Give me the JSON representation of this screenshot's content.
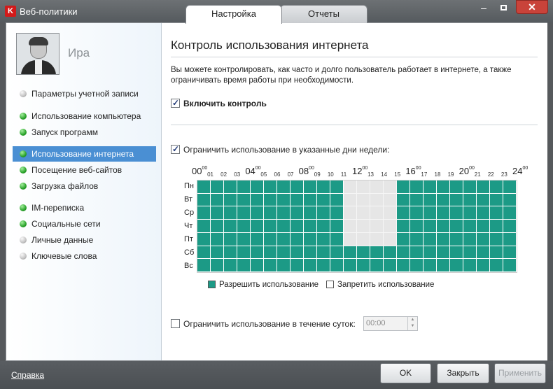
{
  "window": {
    "title": "Веб-политики",
    "app_icon": "K"
  },
  "tabs": [
    {
      "label": "Настройка",
      "active": true
    },
    {
      "label": "Отчеты",
      "active": false
    }
  ],
  "window_buttons": {
    "minimize": "–",
    "close": "✕"
  },
  "user": {
    "name": "Ира"
  },
  "sidebar": {
    "items": [
      {
        "label": "Параметры учетной записи",
        "status": "gray"
      },
      {
        "label": "Использование компьютера",
        "status": "green"
      },
      {
        "label": "Запуск программ",
        "status": "green"
      },
      {
        "label": "Использование интернета",
        "status": "green",
        "selected": true
      },
      {
        "label": "Посещение веб-сайтов",
        "status": "green"
      },
      {
        "label": "Загрузка файлов",
        "status": "green"
      },
      {
        "label": "IM-переписка",
        "status": "green"
      },
      {
        "label": "Социальные сети",
        "status": "green"
      },
      {
        "label": "Личные данные",
        "status": "gray"
      },
      {
        "label": "Ключевые слова",
        "status": "gray"
      }
    ]
  },
  "main": {
    "title": "Контроль использования интернета",
    "description": "Вы можете контролировать, как часто и долго пользователь работает в интернете, а также ограничивать время работы при необходимости.",
    "enable_control": {
      "label": "Включить контроль",
      "checked": true
    },
    "limit_days": {
      "label": "Ограничить использование в указанные дни недели:",
      "checked": true
    },
    "limit_daily": {
      "label": "Ограничить использование в течение суток:",
      "checked": false,
      "value": "00:00"
    }
  },
  "schedule": {
    "hour_labels": [
      "00",
      "01",
      "02",
      "03",
      "04",
      "05",
      "06",
      "07",
      "08",
      "09",
      "10",
      "11",
      "12",
      "13",
      "14",
      "15",
      "16",
      "17",
      "18",
      "19",
      "20",
      "21",
      "22",
      "23",
      "24"
    ],
    "hour_sup": "00",
    "days": [
      "Пн",
      "Вт",
      "Ср",
      "Чт",
      "Пт",
      "Сб",
      "Вс"
    ],
    "denied": {
      "Пн": [
        11,
        12,
        13,
        14
      ],
      "Вт": [
        11,
        12,
        13,
        14
      ],
      "Ср": [
        11,
        12,
        13,
        14
      ],
      "Чт": [
        11,
        12,
        13,
        14
      ],
      "Пт": [
        11,
        12,
        13,
        14
      ],
      "Сб": [],
      "Вс": []
    },
    "legend": {
      "allow": "Разрешить использование",
      "deny": "Запретить использование",
      "allow_color": "#1c9a86",
      "deny_color": "#e6e6e6"
    }
  },
  "footer": {
    "help": "Справка",
    "ok": "OK",
    "close": "Закрыть",
    "apply": "Применить"
  }
}
